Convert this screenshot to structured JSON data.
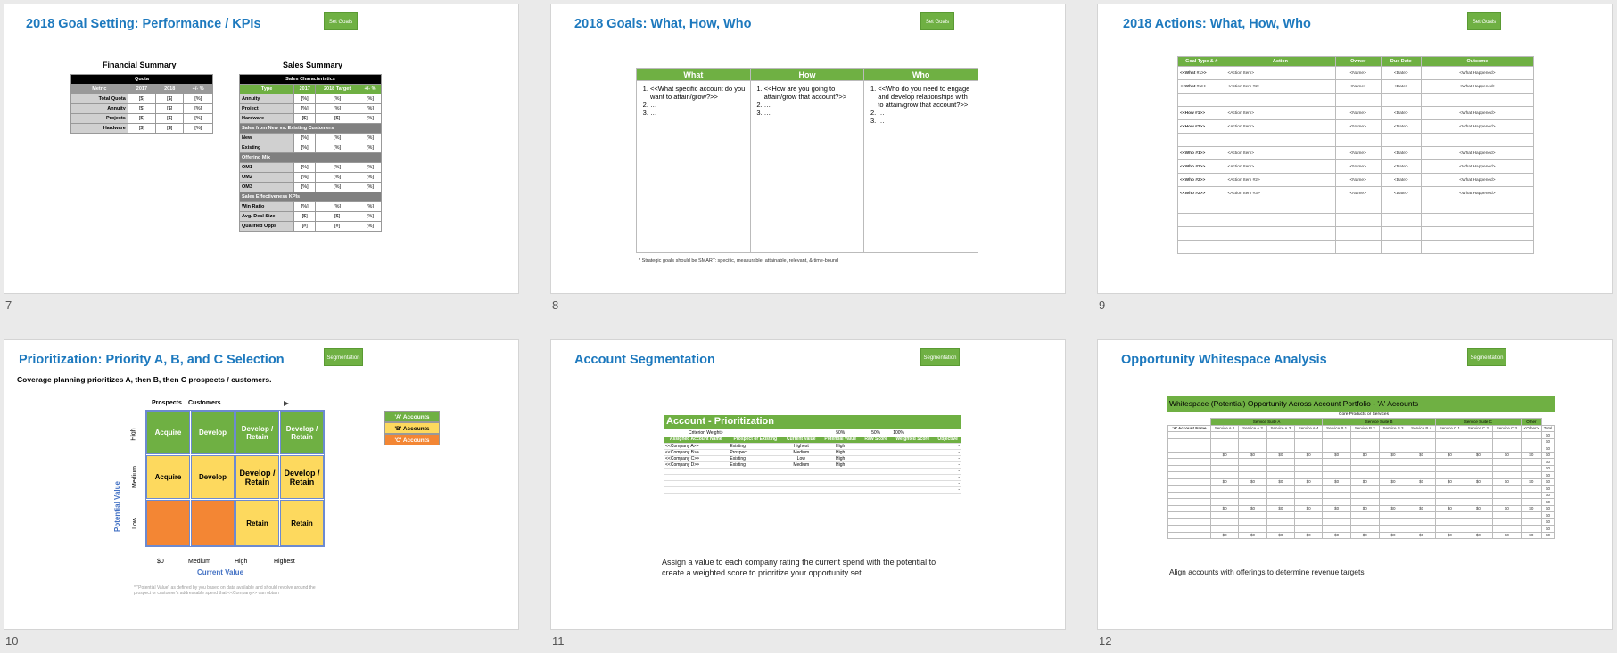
{
  "slides": [
    {
      "num": "7",
      "title": "2018 Goal Setting: Performance / KPIs",
      "button": "Set Goals"
    },
    {
      "num": "8",
      "title": "2018 Goals: What, How, Who",
      "button": "Set Goals"
    },
    {
      "num": "9",
      "title": "2018 Actions: What, How, Who",
      "button": "Set Goals"
    },
    {
      "num": "10",
      "title": "Prioritization: Priority A, B, and C Selection",
      "button": "Segmentation"
    },
    {
      "num": "11",
      "title": "Account Segmentation",
      "button": "Segmentation"
    },
    {
      "num": "12",
      "title": "Opportunity Whitespace Analysis",
      "button": "Segmentation"
    }
  ],
  "s7": {
    "fin_title": "Financial Summary",
    "fin_head": "Quota",
    "fin_cols": [
      "Metric",
      "2017",
      "2018",
      "+/- %"
    ],
    "fin_rows": [
      [
        "Total Quota",
        "[$]",
        "[$]",
        "[%]"
      ],
      [
        "Annuity",
        "[$]",
        "[$]",
        "[%]"
      ],
      [
        "Projects",
        "[$]",
        "[$]",
        "[%]"
      ],
      [
        "Hardware",
        "[$]",
        "[$]",
        "[%]"
      ]
    ],
    "sal_title": "Sales Summary",
    "sal_head": "Sales Characteristics",
    "sal_cols": [
      "Type",
      "2017",
      "2018 Target",
      "+/- %"
    ],
    "sal_sections": [
      {
        "rows": [
          [
            "Annuity",
            "[%]",
            "[%]",
            "[%]"
          ],
          [
            "Project",
            "[%]",
            "[%]",
            "[%]"
          ],
          [
            "Hardware",
            "[$]",
            "[$]",
            "[%]"
          ]
        ]
      },
      {
        "name": "Sales from New vs. Existing Customers",
        "rows": [
          [
            "New",
            "[%]",
            "[%]",
            "[%]"
          ],
          [
            "Existing",
            "[%]",
            "[%]",
            "[%]"
          ]
        ]
      },
      {
        "name": "Offering Mix",
        "rows": [
          [
            "OM1",
            "[%]",
            "[%]",
            "[%]"
          ],
          [
            "OM2",
            "[%]",
            "[%]",
            "[%]"
          ],
          [
            "OM3",
            "[%]",
            "[%]",
            "[%]"
          ]
        ]
      },
      {
        "name": "Sales Effectiveness KPIs",
        "rows": [
          [
            "Win Ratio",
            "[%]",
            "[%]",
            "[%]"
          ],
          [
            "Avg. Deal Size",
            "[$]",
            "[$]",
            "[%]"
          ],
          [
            "Qualified Opps",
            "[#]",
            "[#]",
            "[%]"
          ]
        ]
      }
    ]
  },
  "s8": {
    "cols": [
      "What",
      "How",
      "Who"
    ],
    "what": [
      "<<What specific account do you want to attain/grow?>>",
      "…",
      "…"
    ],
    "how": [
      "<<How are you going to attain/grow that account?>>",
      "…",
      "…"
    ],
    "who": [
      "<<Who do you need to engage and develop relationships with to attain/grow that account?>>",
      "…",
      "…"
    ],
    "note": "* Strategic goals should be SMART: specific, measurable, attainable, relevant, & time-bound"
  },
  "s9": {
    "cols": [
      "Goal Type & #",
      "Action",
      "Owner",
      "Due Date",
      "Outcome"
    ],
    "rows": [
      [
        "<<What #1>>",
        "<Action Item>",
        "<Name>",
        "<Date>",
        "<What Happened>"
      ],
      [
        "<<What #1>>",
        "<Action Item #2>",
        "<Name>",
        "<Date>",
        "<What Happened>"
      ],
      [
        "",
        "",
        "",
        "",
        ""
      ],
      [
        "<<How #1>>",
        "<Action Item>",
        "<Name>",
        "<Date>",
        "<What Happened>"
      ],
      [
        "<<How #2>>",
        "<Action Item>",
        "<Name>",
        "<Date>",
        "<What Happened>"
      ],
      [
        "",
        "",
        "",
        "",
        ""
      ],
      [
        "<<Who #1>>",
        "<Action Item>",
        "<Name>",
        "<Date>",
        "<What Happened>"
      ],
      [
        "<<Who #2>>",
        "<Action Item>",
        "<Name>",
        "<Date>",
        "<What Happened>"
      ],
      [
        "<<Who #2>>",
        "<Action Item #2>",
        "<Name>",
        "<Date>",
        "<What Happened>"
      ],
      [
        "<<Who #2>>",
        "<Action Item #3>",
        "<Name>",
        "<Date>",
        "<What Happened>"
      ],
      [
        "",
        "",
        "",
        "",
        ""
      ],
      [
        "",
        "",
        "",
        "",
        ""
      ],
      [
        "",
        "",
        "",
        "",
        ""
      ],
      [
        "",
        "",
        "",
        "",
        ""
      ]
    ]
  },
  "s10": {
    "subtitle": "Coverage planning prioritizes A, then B, then C prospects / customers.",
    "prospects": "Prospects",
    "customers": "Customers",
    "y_axis": "Potential Value",
    "y_ticks": [
      "High",
      "Medium",
      "Low"
    ],
    "x_axis": "Current Value",
    "x_ticks": [
      "$0",
      "Medium",
      "High",
      "Highest"
    ],
    "cells": [
      [
        "Acquire",
        "Develop",
        "Develop / Retain",
        "Develop / Retain"
      ],
      [
        "Acquire",
        "Develop",
        "Develop / Retain",
        "Develop / Retain"
      ],
      [
        "",
        "",
        "Retain",
        "Retain"
      ]
    ],
    "legend": [
      "'A' Accounts",
      "'B' Accounts",
      "'C' Accounts"
    ],
    "note": "* \"Potential Value\" as defined by you based on data available and should revolve around the prospect or customer's addressable spend that <<Company>> can obtain"
  },
  "s11": {
    "header": "Account - Prioritization",
    "weight_label": "Criterion Weight>",
    "weights": [
      "50%",
      "50%",
      "100%"
    ],
    "cols": [
      "Assigned Account Name",
      "Prospect or Existing",
      "Current Value",
      "Potential Value",
      "Raw Score",
      "Weighted Score",
      "Objective"
    ],
    "rows": [
      [
        "<<Company A>>",
        "Existing",
        "Highest",
        "High",
        "",
        "",
        "-"
      ],
      [
        "<<Company B>>",
        "Prospect",
        "Medium",
        "High",
        "",
        "",
        "-"
      ],
      [
        "<<Company C>>",
        "Existing",
        "Low",
        "High",
        "",
        "",
        "-"
      ],
      [
        "<<Company D>>",
        "Existing",
        "Medium",
        "High",
        "",
        "",
        "-"
      ],
      [
        "",
        "",
        "",
        "",
        "",
        "",
        "-"
      ],
      [
        "",
        "",
        "",
        "",
        "",
        "",
        "-"
      ],
      [
        "",
        "",
        "",
        "",
        "",
        "",
        "-"
      ],
      [
        "",
        "",
        "",
        "",
        "",
        "",
        "-"
      ]
    ],
    "text": "Assign a value to each company rating the current spend with the potential to create a weighted score to prioritize your opportunity set."
  },
  "s12": {
    "header": "Whitespace (Potential) Opportunity Across Account Portfolio - 'A' Accounts",
    "group_title": "Core Products or Services",
    "account_col": "'A' Account Name",
    "suites": [
      "Service Suite A",
      "Service Suite B",
      "Service Suite C",
      "Other"
    ],
    "services": [
      "Service A.1",
      "Service A.2",
      "Service A.3",
      "Service A.4",
      "Service B.1",
      "Service B.2",
      "Service B.3",
      "Service B.4",
      "Service C.1",
      "Service C.2",
      "Service C.3",
      "<Other>",
      "Total"
    ],
    "zero": "$0",
    "text": "Align accounts with offerings to determine revenue targets"
  }
}
